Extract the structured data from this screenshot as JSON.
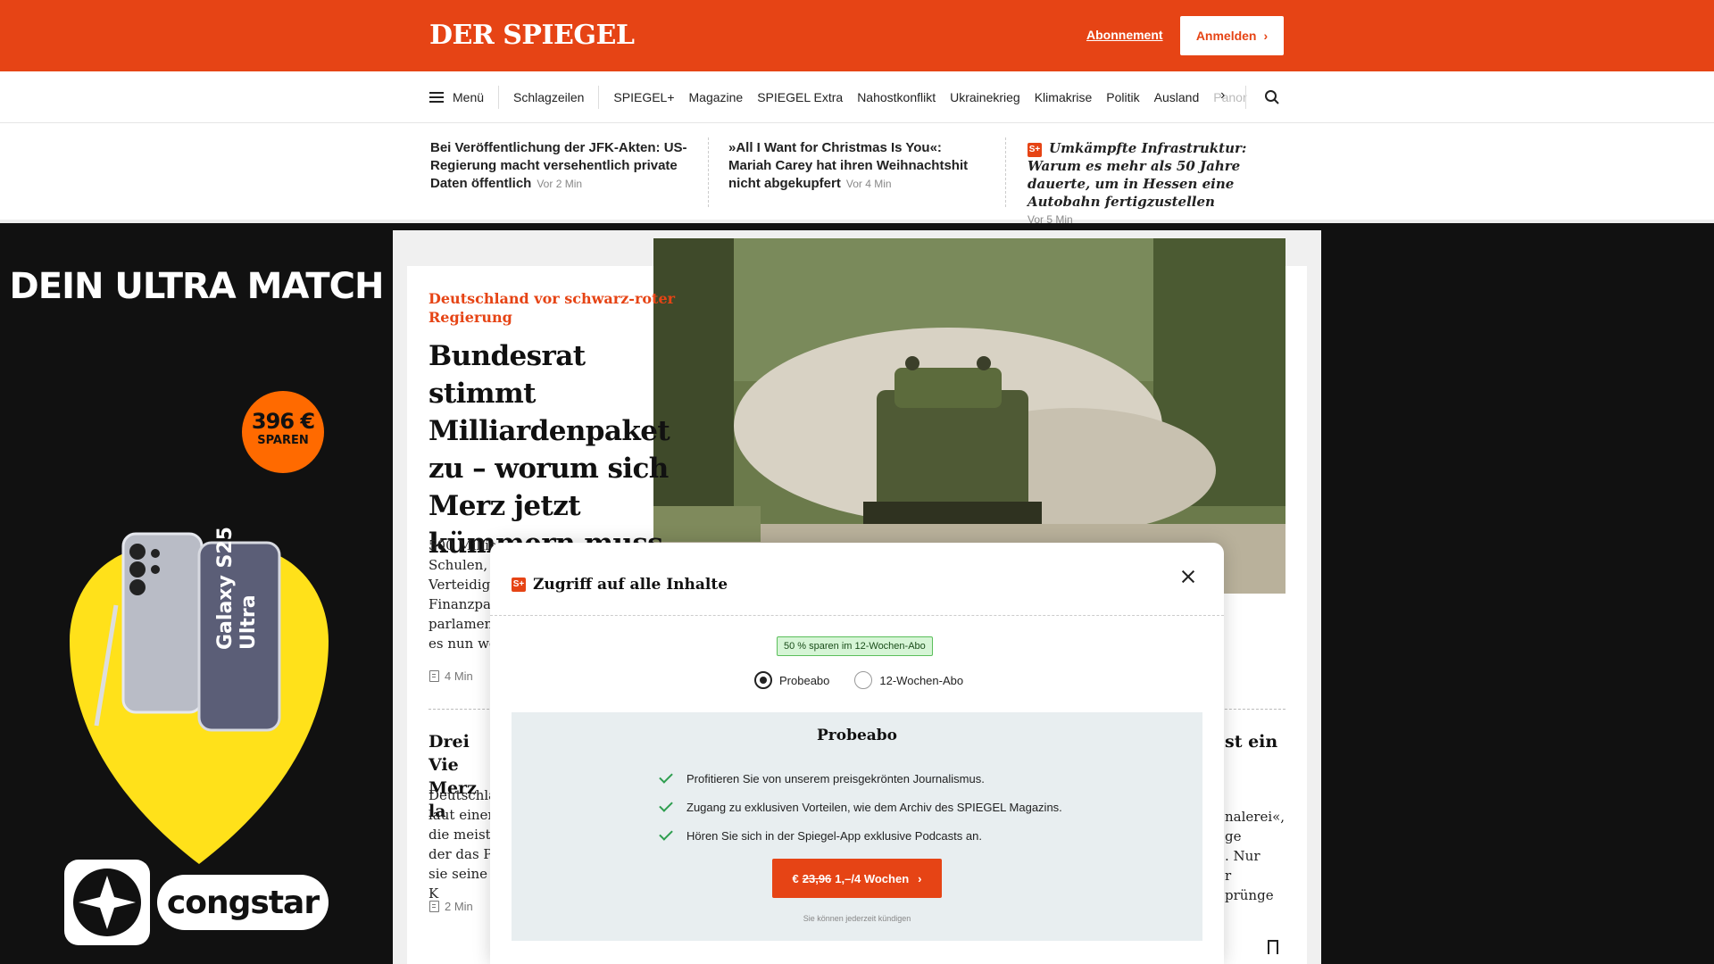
{
  "header": {
    "logo": "DER SPIEGEL",
    "abo_link": "Abonnement",
    "login_button": "Anmelden",
    "accent_color": "#e64415"
  },
  "nav": {
    "menu_label": "Menü",
    "items": [
      "Schlagzeilen",
      "SPIEGEL+",
      "Magazine",
      "SPIEGEL Extra",
      "Nahostkonflikt",
      "Ukrainekrieg",
      "Klimakrise",
      "Politik",
      "Ausland",
      "Panor"
    ]
  },
  "ticker": [
    {
      "title": "Bei Veröffentlichung der JFK-Akten: US-Regierung macht versehentlich private Daten öffentlich",
      "time": "Vor 2 Min"
    },
    {
      "title": "»All I Want for Christmas Is You«: Mariah Carey hat ihren Weihnachtshit nicht abgekupfert",
      "time": "Vor 4 Min"
    },
    {
      "badge": "S+",
      "title": "Umkämpfte Infrastruktur: Warum es mehr als 50 Jahre dauerte, um in Hessen eine Autobahn fertigzustellen",
      "time": "Vor 5 Min"
    }
  ],
  "lead": {
    "kicker": "Deutschland vor schwarz-roter Regierung",
    "headline": "Bundesrat stimmt Milliardenpaket zu – worum sich Merz jetzt kümmern muss",
    "teaser_lines": [
      "500 Millia",
      "Schulen, k",
      "Verteidigu",
      "Finanzpal",
      "parlament",
      "es nun we"
    ],
    "read_time": "4 Min"
  },
  "second_article": {
    "headline_lines": [
      "Drei Vie",
      "Merz la"
    ],
    "teaser_lines": [
      "Deutschla",
      "laut einer",
      "die meiste",
      "der das Pa",
      "sie seine K"
    ],
    "read_time": "2 Min"
  },
  "third_article": {
    "headline_fragment": "st ein",
    "teaser_lines": [
      "nalerei«,",
      "ge",
      ". Nur",
      "r",
      "prünge"
    ]
  },
  "ad": {
    "title": "DEIN ULTRA MATCH",
    "save_amount": "396 €",
    "save_label": "SPAREN",
    "product": "Galaxy S25 Ultra",
    "brand": "congstar"
  },
  "modal": {
    "title": "Zugriff auf alle Inhalte",
    "promo": "50 % sparen im 12-Wochen-Abo",
    "options": [
      "Probeabo",
      "12-Wochen-Abo"
    ],
    "selected": "Probeabo",
    "offer_title": "Probeabo",
    "benefits": [
      "Profitieren Sie von unserem preisgekrönten Journalismus.",
      "Zugang zu exklusiven Vorteilen, wie dem Archiv des SPIEGEL Magazins.",
      "Hören Sie sich in der Spiegel-App exklusive Podcasts an."
    ],
    "cta_currency": "€",
    "cta_old_price": "23,96",
    "cta_new_price": "1,–/4 Wochen",
    "cancel_note": "Sie können jederzeit kündigen"
  }
}
